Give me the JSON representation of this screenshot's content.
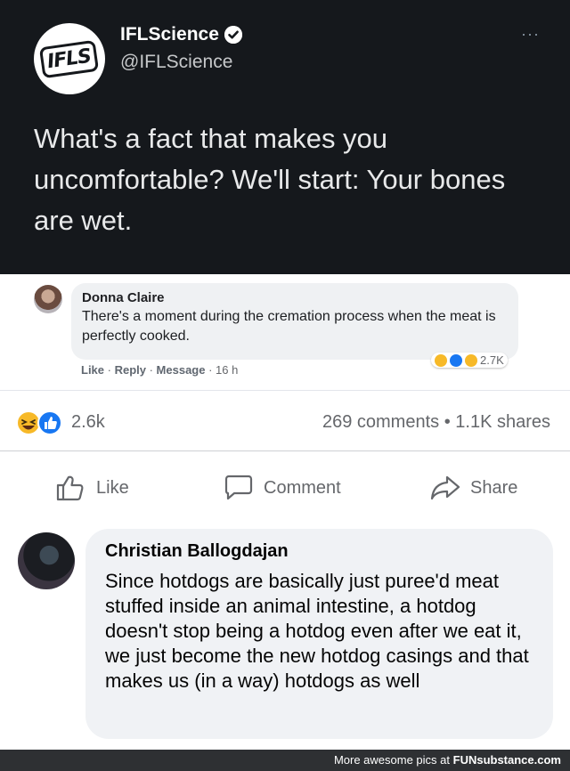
{
  "tweet": {
    "logo": "IFLS",
    "name": "IFLScience",
    "handle": "@IFLScience",
    "more": "···",
    "text": "What's a fact that makes you uncomfortable? We'll start: Your bones are wet.",
    "icons": [
      "ifls-logo-icon",
      "verified-badge-icon",
      "more-options-icon"
    ]
  },
  "inner_comment": {
    "name": "Donna Claire",
    "text": "There's a moment during the cremation process when the meat is perfectly cooked.",
    "actions": {
      "like": "Like",
      "reply": "Reply",
      "message": "Message",
      "time": "16 h"
    },
    "reaction_count": "2.7K"
  },
  "post_stats": {
    "reaction_count": "2.6k",
    "comments": "269 comments",
    "separator": "•",
    "shares": "1.1K shares"
  },
  "post_actions": {
    "like": "Like",
    "comment": "Comment",
    "share": "Share"
  },
  "comment": {
    "name": "Christian Ballogdajan",
    "text": "Since hotdogs are basically just puree'd meat stuffed inside an animal intestine, a hotdog doesn't stop being a hotdog even after we eat it, we just become the new hotdog casings and that makes us (in a way) hotdogs as well"
  },
  "footer": {
    "text": "More awesome pics at",
    "brand": "FUNsubstance.com"
  },
  "colors": {
    "tweet_bg": "#15181c",
    "like_blue": "#1877f2",
    "haha_yellow": "#f7b928",
    "muted": "#65676b"
  }
}
